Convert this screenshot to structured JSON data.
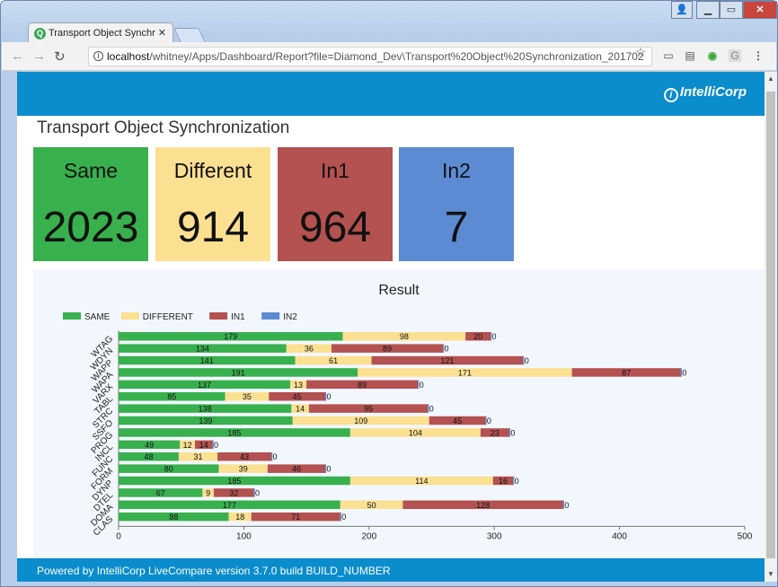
{
  "browser": {
    "tab_title": "Transport Object Synchr",
    "url_host": "localhost",
    "url_path": "/whitney/Apps/Dashboard/Report?file=Diamond_Dev\\Transport%20Object%20Synchronization_201702"
  },
  "brand": {
    "logo": "IntelliCorp",
    "logo_mark": "i"
  },
  "page": {
    "title": "Transport Object Synchronization"
  },
  "cards": [
    {
      "label": "Same",
      "value": "2023",
      "color": "#38b04e"
    },
    {
      "label": "Different",
      "value": "914",
      "color": "#fbe091"
    },
    {
      "label": "In1",
      "value": "964",
      "color": "#b35250"
    },
    {
      "label": "In2",
      "value": "7",
      "color": "#5c8bd4"
    }
  ],
  "footer": {
    "text": "Powered by IntelliCorp LiveCompare version 3.7.0 build BUILD_NUMBER"
  },
  "chart_data": {
    "type": "bar",
    "orientation": "horizontal",
    "stacked": true,
    "title": "Result",
    "legend_position": "top-left",
    "xlim": [
      0,
      500
    ],
    "x_ticks": [
      0,
      100,
      200,
      300,
      400,
      500
    ],
    "categories": [
      "WTAG",
      "WDYN",
      "WAPP",
      "WAPA",
      "VARX",
      "TABL",
      "STRC",
      "SSFO",
      "PROG",
      "INCL",
      "FUNC",
      "FORM",
      "DYNP",
      "DTEL",
      "DOMA",
      "CLAS"
    ],
    "series": [
      {
        "name": "SAME",
        "color": "#38b04e",
        "values": [
          179,
          134,
          141,
          191,
          137,
          85,
          138,
          139,
          185,
          49,
          48,
          80,
          185,
          67,
          177,
          88
        ]
      },
      {
        "name": "DIFFERENT",
        "color": "#fbe091",
        "values": [
          98,
          36,
          61,
          171,
          13,
          35,
          14,
          109,
          104,
          12,
          31,
          39,
          114,
          9,
          50,
          18
        ]
      },
      {
        "name": "IN1",
        "color": "#b35250",
        "values": [
          20,
          89,
          121,
          87,
          89,
          45,
          95,
          45,
          23,
          14,
          43,
          46,
          16,
          32,
          128,
          71
        ]
      },
      {
        "name": "IN2",
        "color": "#5c8bd4",
        "values": [
          0,
          0,
          0,
          0,
          0,
          0,
          0,
          0,
          0,
          0,
          0,
          0,
          0,
          0,
          0,
          0
        ]
      }
    ]
  }
}
